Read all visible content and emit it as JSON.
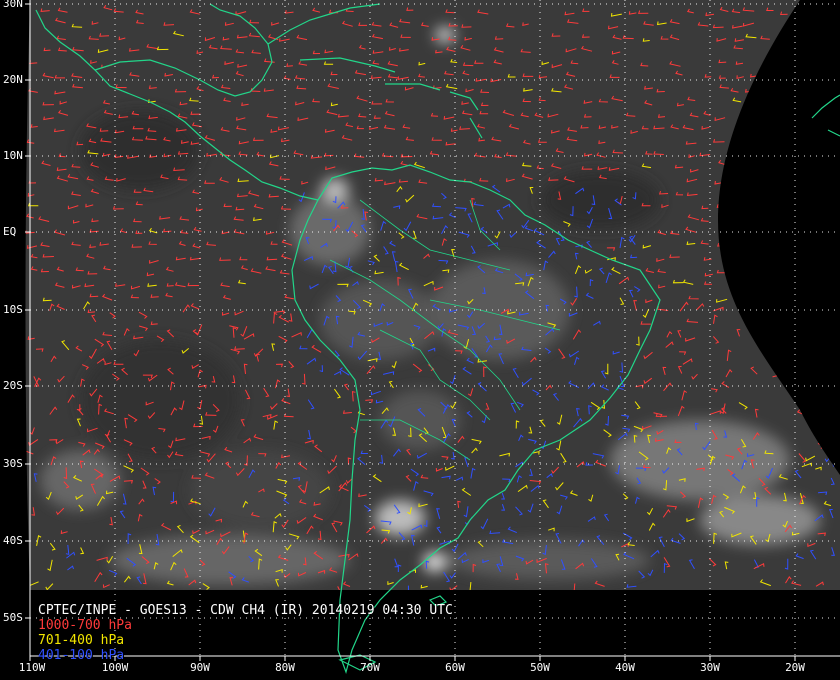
{
  "caption": {
    "title": "CPTEC/INPE - GOES13 - CDW CH4 (IR) 20140219 04:30 UTC"
  },
  "legend": [
    {
      "label": "1000-700 hPa",
      "color": "#ff3a3a"
    },
    {
      "label": "701-400 hPa",
      "color": "#f2e600"
    },
    {
      "label": "401-100 hPa",
      "color": "#3050ff"
    }
  ],
  "latitude_labels": [
    "30N",
    "20N",
    "10N",
    "EQ",
    "10S",
    "20S",
    "30S",
    "40S",
    "50S"
  ],
  "longitude_labels": [
    "110W",
    "100W",
    "90W",
    "80W",
    "70W",
    "60W",
    "50W",
    "40W",
    "30W",
    "20W"
  ],
  "colors": {
    "background": "#000000",
    "coastline": "#22d68a",
    "grid": "#ffffff",
    "cloud_base": "#3a3a3a"
  }
}
